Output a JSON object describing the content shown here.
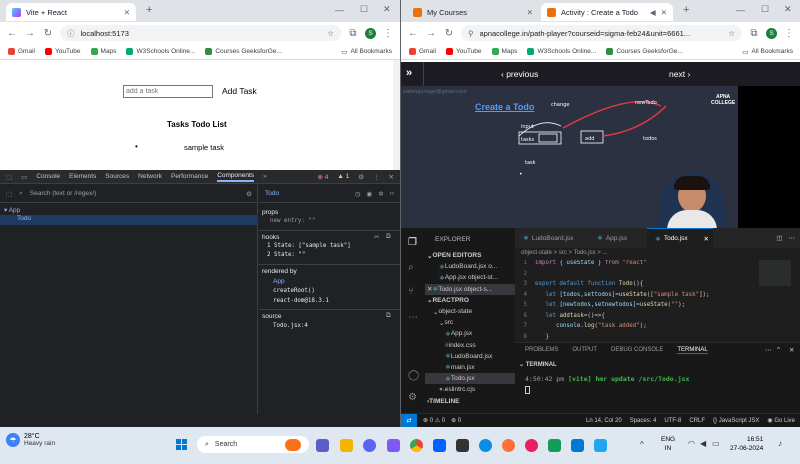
{
  "left_browser": {
    "tab_title": "Vite + React",
    "address": "localhost:5173",
    "profile_initial": "S",
    "bookmarks": [
      "Gmail",
      "YouTube",
      "Maps",
      "W3Schools Online...",
      "Courses GeeksforGe..."
    ],
    "all_bookmarks": "All Bookmarks",
    "app": {
      "input_placeholder": "add a task",
      "add_button": "Add Task",
      "list_heading": "Tasks Todo List",
      "tasks": [
        "sample task"
      ]
    }
  },
  "devtools": {
    "tabs": [
      "Console",
      "Elements",
      "Sources",
      "Network",
      "Performance",
      "Components"
    ],
    "error_count": "4",
    "warning_count": "1",
    "search_placeholder": "Search (text or /regex/)",
    "tree": [
      "App",
      "Todo"
    ],
    "selected_component": "Todo",
    "props_label": "props",
    "new_entry": "new entry: \"\"",
    "hooks_label": "hooks",
    "hooks": [
      "1 State: [\"sample task\"]",
      "2 State: \"\""
    ],
    "rendered_by_label": "rendered by",
    "rendered_by": [
      "App",
      "createRoot()",
      "react-dom@18.3.1"
    ],
    "source_label": "source",
    "source": "Todo.jsx:4"
  },
  "right_browser": {
    "tabs": [
      "My Courses",
      "Activity : Create a Todo"
    ],
    "address": "apnacollege.in/path-player?courseid=sigma-feb24&unit=6661...",
    "bookmarks": [
      "Gmail",
      "YouTube",
      "Maps",
      "W3Schools Online...",
      "Courses GeeksforGe..."
    ],
    "all_bookmarks": "All Bookmarks",
    "player": {
      "previous": "previous",
      "next": "next",
      "email_watermark": "satishgurtago@gmail.com",
      "slide_title": "Create a Todo",
      "brand_top": "APNA",
      "brand_bottom": "COLLEGE",
      "sketch_labels": [
        "change",
        "input",
        "tasks",
        "add",
        "newTodo",
        "todos",
        "task"
      ]
    }
  },
  "vscode": {
    "explorer_label": "EXPLORER",
    "open_editors_label": "OPEN EDITORS",
    "open_editors": [
      "LudoBoard.jsx o...",
      "App.jsx object-st...",
      "Todo.jsx object-s..."
    ],
    "project_label": "REACTPRO",
    "tree": [
      "object-state",
      "src",
      "App.jsx",
      "index.css",
      "LudoBoard.jsx",
      "main.jsx",
      "Todo.jsx",
      ".eslintrc.cjs"
    ],
    "timeline_label": "TIMELINE",
    "editor_tabs": [
      "LudoBoard.jsx",
      "App.jsx",
      "Todo.jsx"
    ],
    "breadcrumb": "object-state > src > Todo.jsx > ...",
    "code": [
      "import { useState } from \"react\"",
      "",
      "export default function Todo(){",
      "    let [todos,settodos]=useState([\"sample task\"]);",
      "    let [newtodos,setnewtodos]=useState(\"\");",
      "    let addtask=()=>{",
      "        console.log(\"task added\");",
      "    }",
      "    return (",
      "        <div>"
    ],
    "panel_tabs": [
      "PROBLEMS",
      "OUTPUT",
      "DEBUG CONSOLE",
      "TERMINAL"
    ],
    "terminal_label": "TERMINAL",
    "terminal_time": "4:50:42 pm",
    "terminal_msg": "[vite] hmr update /src/Todo.jsx",
    "status_left": [
      "⊗ 0 ⚠ 0",
      "⊕ 0"
    ],
    "status_right": [
      "Ln 14, Col 20",
      "Spaces: 4",
      "UTF-8",
      "CRLF",
      "{} JavaScript JSX",
      "Go Live"
    ]
  },
  "taskbar": {
    "weather_temp": "28°C",
    "weather_desc": "Heavy rain",
    "search_label": "Search",
    "lang_top": "ENG",
    "lang_bottom": "IN",
    "time": "16:51",
    "date": "27-06-2024"
  },
  "colors": {
    "accent_blue": "#1a73e8",
    "vscode_bg": "#1e1e1e",
    "video_bg": "#2b3140"
  }
}
